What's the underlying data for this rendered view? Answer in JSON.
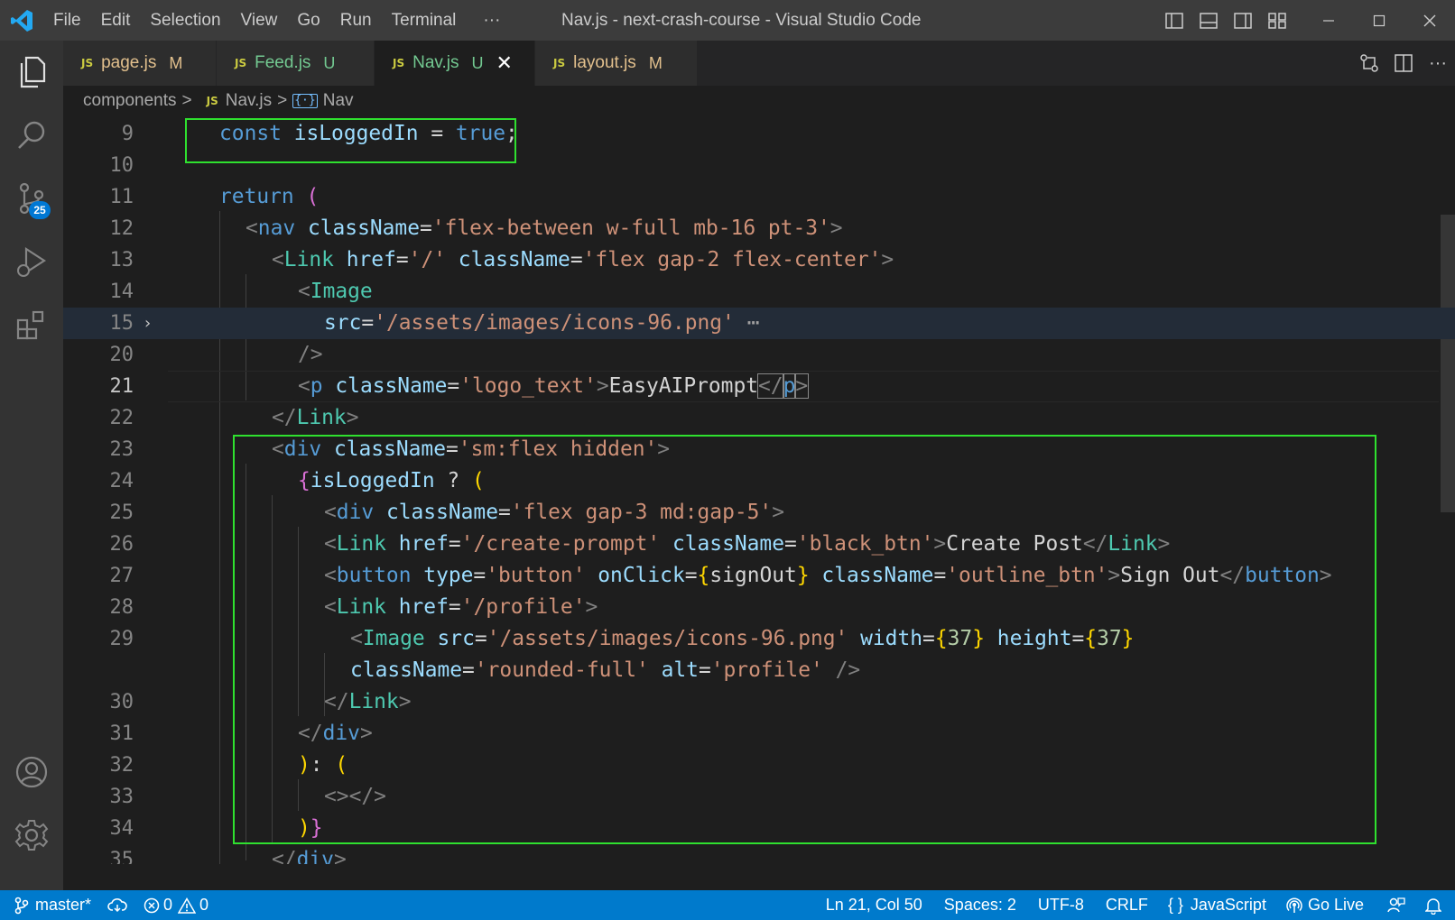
{
  "app": {
    "window_title": "Nav.js - next-crash-course - Visual Studio Code",
    "menu": [
      "File",
      "Edit",
      "Selection",
      "View",
      "Go",
      "Run",
      "Terminal",
      "···"
    ]
  },
  "activity_bar": {
    "source_control_badge": "25"
  },
  "tabs": [
    {
      "lang": "JS",
      "name": "page.js",
      "status": "M",
      "color": "#e2c08d",
      "active": false
    },
    {
      "lang": "JS",
      "name": "Feed.js",
      "status": "U",
      "color": "#73c991",
      "active": false
    },
    {
      "lang": "JS",
      "name": "Nav.js",
      "status": "U",
      "color": "#73c991",
      "active": true,
      "close": "✕"
    },
    {
      "lang": "JS",
      "name": "layout.js",
      "status": "M",
      "color": "#e2c08d",
      "active": false
    }
  ],
  "breadcrumb": {
    "folder": "components",
    "sep": ">",
    "lang": "JS",
    "file": "Nav.js",
    "symbol_icon": "{·}",
    "symbol": "Nav"
  },
  "editor": {
    "lines": [
      {
        "n": "9",
        "tokens": [
          [
            "k",
            "const "
          ],
          [
            "v",
            "isLoggedIn"
          ],
          [
            "w",
            " = "
          ],
          [
            "k",
            "true"
          ],
          [
            "w",
            ";"
          ]
        ]
      },
      {
        "n": "10",
        "tokens": []
      },
      {
        "n": "11",
        "tokens": [
          [
            "k",
            "return "
          ],
          [
            "m",
            "("
          ]
        ]
      },
      {
        "n": "12",
        "tokens": [
          [
            "p",
            "<"
          ],
          [
            "k",
            "nav "
          ],
          [
            "v",
            "className"
          ],
          [
            "w",
            "="
          ],
          [
            "s",
            "'flex-between w-full mb-16 pt-3'"
          ],
          [
            "p",
            ">"
          ]
        ]
      },
      {
        "n": "13",
        "tokens": [
          [
            "p",
            "<"
          ],
          [
            "t",
            "Link "
          ],
          [
            "v",
            "href"
          ],
          [
            "w",
            "="
          ],
          [
            "s",
            "'/' "
          ],
          [
            "v",
            "className"
          ],
          [
            "w",
            "="
          ],
          [
            "s",
            "'flex gap-2 flex-center'"
          ],
          [
            "p",
            ">"
          ]
        ]
      },
      {
        "n": "14",
        "tokens": [
          [
            "p",
            "<"
          ],
          [
            "t",
            "Image"
          ]
        ]
      },
      {
        "n": "15",
        "tokens": [
          [
            "v",
            "src"
          ],
          [
            "w",
            "="
          ],
          [
            "s",
            "'/assets/images/icons-96.png'"
          ],
          [
            "ellipsis",
            " ⋯"
          ]
        ]
      },
      {
        "n": "20",
        "tokens": [
          [
            "p",
            "/>"
          ]
        ]
      },
      {
        "n": "21",
        "tokens": [
          [
            "p",
            "<"
          ],
          [
            "k",
            "p "
          ],
          [
            "v",
            "className"
          ],
          [
            "w",
            "="
          ],
          [
            "s",
            "'logo_text'"
          ],
          [
            "p",
            ">"
          ],
          [
            "w",
            "EasyAIPrompt"
          ],
          [
            "pm",
            "</"
          ],
          [
            "km",
            "p"
          ],
          [
            "pm",
            ">"
          ]
        ]
      },
      {
        "n": "22",
        "tokens": [
          [
            "p",
            "</"
          ],
          [
            "t",
            "Link"
          ],
          [
            "p",
            ">"
          ]
        ]
      },
      {
        "n": "23",
        "tokens": [
          [
            "p",
            "<"
          ],
          [
            "k",
            "div "
          ],
          [
            "v",
            "className"
          ],
          [
            "w",
            "="
          ],
          [
            "s",
            "'sm:flex hidden'"
          ],
          [
            "p",
            ">"
          ]
        ]
      },
      {
        "n": "24",
        "tokens": [
          [
            "m",
            "{"
          ],
          [
            "v",
            "isLoggedIn "
          ],
          [
            "w",
            "? "
          ],
          [
            "y",
            "("
          ]
        ]
      },
      {
        "n": "25",
        "tokens": [
          [
            "p",
            "<"
          ],
          [
            "k",
            "div "
          ],
          [
            "v",
            "className"
          ],
          [
            "w",
            "="
          ],
          [
            "s",
            "'flex gap-3 md:gap-5'"
          ],
          [
            "p",
            ">"
          ]
        ]
      },
      {
        "n": "26",
        "tokens": [
          [
            "p",
            "<"
          ],
          [
            "t",
            "Link "
          ],
          [
            "v",
            "href"
          ],
          [
            "w",
            "="
          ],
          [
            "s",
            "'/create-prompt' "
          ],
          [
            "v",
            "className"
          ],
          [
            "w",
            "="
          ],
          [
            "s",
            "'black_btn'"
          ],
          [
            "p",
            ">"
          ],
          [
            "w",
            "Create Post"
          ],
          [
            "p",
            "</"
          ],
          [
            "t",
            "Link"
          ],
          [
            "p",
            ">"
          ]
        ]
      },
      {
        "n": "27",
        "tokens": [
          [
            "p",
            "<"
          ],
          [
            "k",
            "button "
          ],
          [
            "v",
            "type"
          ],
          [
            "w",
            "="
          ],
          [
            "s",
            "'button' "
          ],
          [
            "v",
            "onClick"
          ],
          [
            "w",
            "="
          ],
          [
            "y",
            "{"
          ],
          [
            "w",
            "signOut"
          ],
          [
            "y",
            "} "
          ],
          [
            "v",
            "className"
          ],
          [
            "w",
            "="
          ],
          [
            "s",
            "'outline_btn'"
          ],
          [
            "p",
            ">"
          ],
          [
            "w",
            "Sign Out"
          ],
          [
            "p",
            "</"
          ],
          [
            "k",
            "button"
          ],
          [
            "p",
            ">"
          ]
        ]
      },
      {
        "n": "28",
        "tokens": [
          [
            "p",
            "<"
          ],
          [
            "t",
            "Link "
          ],
          [
            "v",
            "href"
          ],
          [
            "w",
            "="
          ],
          [
            "s",
            "'/profile'"
          ],
          [
            "p",
            ">"
          ]
        ]
      },
      {
        "n": "29",
        "tokens": [
          [
            "p",
            "<"
          ],
          [
            "t",
            "Image "
          ],
          [
            "v",
            "src"
          ],
          [
            "w",
            "="
          ],
          [
            "s",
            "'/assets/images/icons-96.png' "
          ],
          [
            "v",
            "width"
          ],
          [
            "w",
            "="
          ],
          [
            "y",
            "{"
          ],
          [
            "n",
            "37"
          ],
          [
            "y",
            "} "
          ],
          [
            "v",
            "height"
          ],
          [
            "w",
            "="
          ],
          [
            "y",
            "{"
          ],
          [
            "n",
            "37"
          ],
          [
            "y",
            "}"
          ]
        ]
      },
      {
        "n": "",
        "tokens": [
          [
            "v",
            "className"
          ],
          [
            "w",
            "="
          ],
          [
            "s",
            "'rounded-full' "
          ],
          [
            "v",
            "alt"
          ],
          [
            "w",
            "="
          ],
          [
            "s",
            "'profile' "
          ],
          [
            "p",
            "/>"
          ]
        ]
      },
      {
        "n": "30",
        "tokens": [
          [
            "p",
            "</"
          ],
          [
            "t",
            "Link"
          ],
          [
            "p",
            ">"
          ]
        ]
      },
      {
        "n": "31",
        "tokens": [
          [
            "p",
            "</"
          ],
          [
            "k",
            "div"
          ],
          [
            "p",
            ">"
          ]
        ]
      },
      {
        "n": "32",
        "tokens": [
          [
            "y",
            ")"
          ],
          [
            "w",
            ": "
          ],
          [
            "y",
            "("
          ]
        ]
      },
      {
        "n": "33",
        "tokens": [
          [
            "p",
            "<></>"
          ]
        ]
      },
      {
        "n": "34",
        "tokens": [
          [
            "y",
            ")"
          ],
          [
            "m",
            "}"
          ]
        ]
      },
      {
        "n": "35",
        "tokens": [
          [
            "p",
            "</"
          ],
          [
            "k",
            "div"
          ],
          [
            "p",
            ">"
          ]
        ]
      }
    ]
  },
  "status_bar": {
    "branch": "master*",
    "errors": "0",
    "warnings": "0",
    "cursor": "Ln 21, Col 50",
    "spaces": "Spaces: 2",
    "encoding": "UTF-8",
    "eol": "CRLF",
    "language_icon": "{ }",
    "language": "JavaScript",
    "go_live": "Go Live"
  },
  "colors": {
    "status_bar": "#007acc",
    "highlight_box": "#2fe02f",
    "keyword": "#569cd6",
    "string": "#ce9178",
    "component": "#4ec9b0"
  }
}
